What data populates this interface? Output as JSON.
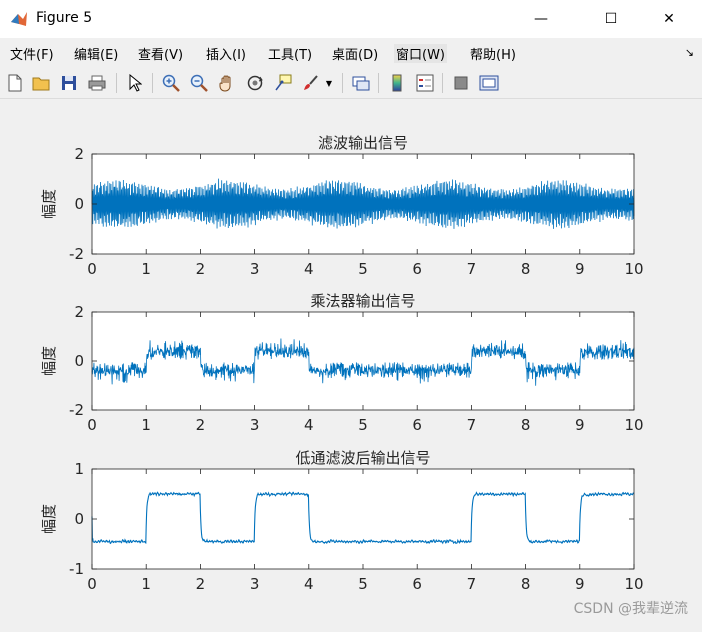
{
  "window": {
    "title": "Figure 5",
    "minimize": "—",
    "maximize": "☐",
    "close": "✕"
  },
  "menu": [
    "文件(F)",
    "编辑(E)",
    "查看(V)",
    "插入(I)",
    "工具(T)",
    "桌面(D)",
    "窗口(W)",
    "帮助(H)"
  ],
  "menu_overflow": "↘",
  "toolbar_icons": [
    "new-figure-icon",
    "open-file-icon",
    "save-icon",
    "print-icon",
    "pointer-icon",
    "zoom-in-icon",
    "zoom-out-icon",
    "pan-icon",
    "rotate-icon",
    "data-cursor-icon",
    "brush-icon",
    "link-plot-icon",
    "colorbar-icon",
    "legend-icon",
    "hide-plot-tools-icon",
    "show-plot-tools-icon"
  ],
  "chart_data": [
    {
      "type": "line",
      "title": "滤波输出信号",
      "xlabel": "",
      "ylabel": "幅度",
      "xlim": [
        0,
        10
      ],
      "ylim": [
        -2,
        2
      ],
      "xticks": [
        "0",
        "1",
        "2",
        "3",
        "4",
        "5",
        "6",
        "7",
        "8",
        "9",
        "10"
      ],
      "yticks": [
        "2",
        "0",
        "-2"
      ],
      "color": "#0072bd",
      "description_series": {
        "kind": "dense-oscillation",
        "amplitude": 1.0,
        "peak_range": [
          -1.3,
          1.35
        ]
      }
    },
    {
      "type": "line",
      "title": "乘法器输出信号",
      "xlabel": "",
      "ylabel": "幅度",
      "xlim": [
        0,
        10
      ],
      "ylim": [
        -2,
        2
      ],
      "xticks": [
        "0",
        "1",
        "2",
        "3",
        "4",
        "5",
        "6",
        "7",
        "8",
        "9",
        "10"
      ],
      "yticks": [
        "2",
        "0",
        "-2"
      ],
      "color": "#0072bd",
      "bit_segments": [
        {
          "x0": 0,
          "x1": 1,
          "level": "low"
        },
        {
          "x0": 1,
          "x1": 2,
          "level": "high"
        },
        {
          "x0": 2,
          "x1": 3,
          "level": "low"
        },
        {
          "x0": 3,
          "x1": 4,
          "level": "high"
        },
        {
          "x0": 4,
          "x1": 7,
          "level": "low"
        },
        {
          "x0": 7,
          "x1": 8,
          "level": "high"
        },
        {
          "x0": 8,
          "x1": 9,
          "level": "low"
        },
        {
          "x0": 9,
          "x1": 10,
          "level": "high"
        }
      ]
    },
    {
      "type": "line",
      "title": "低通滤波后输出信号",
      "xlabel": "",
      "ylabel": "幅度",
      "xlim": [
        0,
        10
      ],
      "ylim": [
        -1,
        1
      ],
      "xticks": [
        "0",
        "1",
        "2",
        "3",
        "4",
        "5",
        "6",
        "7",
        "8",
        "9",
        "10"
      ],
      "yticks": [
        "1",
        "0",
        "-1"
      ],
      "color": "#0072bd",
      "levels": {
        "high": 0.5,
        "low": -0.45
      },
      "segments": [
        {
          "x0": 0,
          "x1": 1,
          "level": -0.45
        },
        {
          "x0": 1,
          "x1": 2,
          "level": 0.5
        },
        {
          "x0": 2,
          "x1": 3,
          "level": -0.45
        },
        {
          "x0": 3,
          "x1": 4,
          "level": 0.5
        },
        {
          "x0": 4,
          "x1": 7,
          "level": -0.45
        },
        {
          "x0": 7,
          "x1": 8,
          "level": 0.5
        },
        {
          "x0": 8,
          "x1": 9,
          "level": -0.45
        },
        {
          "x0": 9,
          "x1": 10,
          "level": 0.5
        }
      ]
    }
  ],
  "watermark": "CSDN @我辈逆流"
}
